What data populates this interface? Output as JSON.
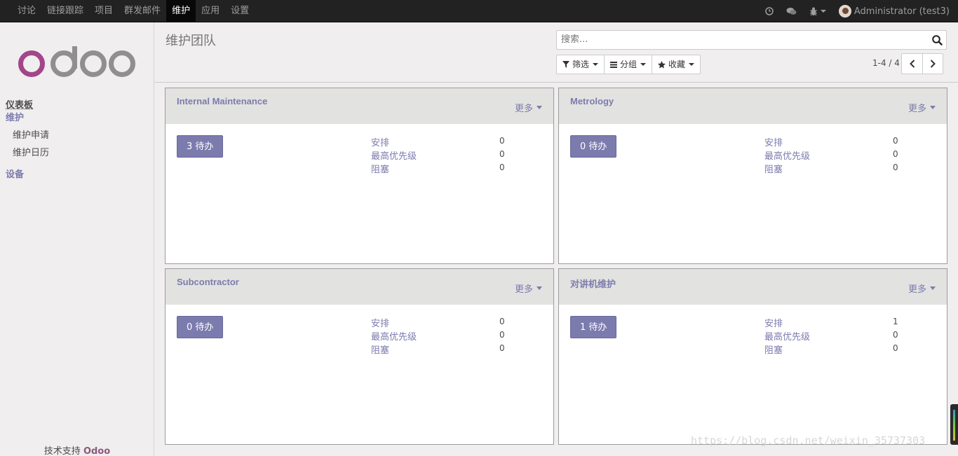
{
  "topbar": {
    "menu": [
      {
        "label": "讨论",
        "active": false
      },
      {
        "label": "链接跟踪",
        "active": false
      },
      {
        "label": "项目",
        "active": false
      },
      {
        "label": "群发邮件",
        "active": false
      },
      {
        "label": "维护",
        "active": true
      },
      {
        "label": "应用",
        "active": false
      },
      {
        "label": "设置",
        "active": false
      }
    ],
    "user": "Administrator (test3)"
  },
  "sidebar": {
    "dashboard": "仪表板",
    "section_maintenance": "维护",
    "items": [
      "维护申请",
      "维护日历"
    ],
    "section_equipment": "设备",
    "footer_text": "技术支持",
    "footer_brand": "Odoo"
  },
  "control_panel": {
    "breadcrumb": "维护团队",
    "search_placeholder": "搜索...",
    "filter_label": "筛选",
    "group_label": "分组",
    "favorites_label": "收藏",
    "pager": "1-4 / 4"
  },
  "row_labels": {
    "scheduled": "安排",
    "top_priority": "最高优先级",
    "blocked": "阻塞"
  },
  "more_label": "更多",
  "teams": [
    {
      "name": "Internal Maintenance",
      "todo": "3 待办",
      "scheduled": "0",
      "top_priority": "0",
      "blocked": "0"
    },
    {
      "name": "Metrology",
      "todo": "0 待办",
      "scheduled": "0",
      "top_priority": "0",
      "blocked": "0"
    },
    {
      "name": "Subcontractor",
      "todo": "0 待办",
      "scheduled": "0",
      "top_priority": "0",
      "blocked": "0"
    },
    {
      "name": "对讲机维护",
      "todo": "1 待办",
      "scheduled": "1",
      "top_priority": "0",
      "blocked": "0"
    }
  ],
  "watermark": "https://blog.csdn.net/weixin_35737303",
  "colors": {
    "brand_purple": "#7c7bad",
    "logo_o": "#875a7b",
    "logo_gray": "#8f8f8f",
    "navbar": "#222222"
  }
}
